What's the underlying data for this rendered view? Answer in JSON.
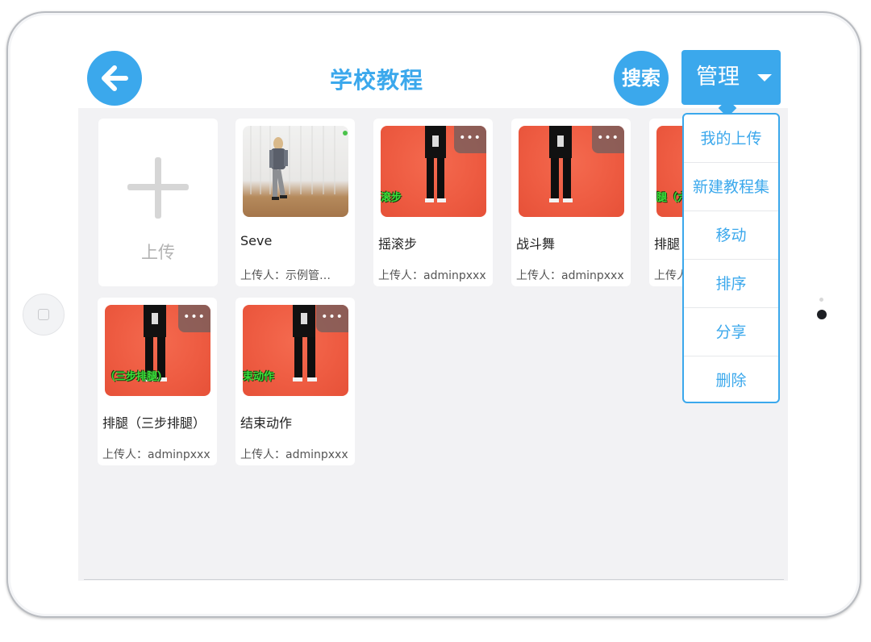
{
  "header": {
    "title": "学校教程",
    "search_label": "搜索",
    "manage_label": "管理"
  },
  "upload_tile": {
    "label": "上传"
  },
  "dropdown": {
    "items": [
      "我的上传",
      "新建教程集",
      "移动",
      "排序",
      "分享",
      "删除"
    ]
  },
  "cards": [
    {
      "name": "Seve",
      "uploader": "上传人：示例管…",
      "thumbnail": "studio"
    },
    {
      "name": "摇滚步",
      "uploader": "上传人：adminpxxx",
      "subtitle": "滚步",
      "thumbnail": "red"
    },
    {
      "name": "战斗舞",
      "uploader": "上传人：adminpxxx",
      "thumbnail": "red"
    },
    {
      "name": "排腿",
      "uploader": "上传人",
      "subtitle": "腿（六",
      "thumbnail": "red"
    },
    {
      "name": "排腿（三步排腿）",
      "uploader": "上传人：adminpxxx",
      "subtitle": "（三步排腿）",
      "thumbnail": "red"
    },
    {
      "name": "结束动作",
      "uploader": "上传人：adminpxxx",
      "subtitle": "束动作",
      "thumbnail": "red"
    }
  ],
  "more_label": "•••",
  "colors": {
    "accent": "#3ba8ec",
    "content_bg": "#f2f2f4",
    "thumb_red": "#ee5c42",
    "subtitle_green": "#39e03a"
  },
  "icons": {
    "back": "arrow-left-icon",
    "caret": "caret-down-icon",
    "plus": "plus-icon",
    "more": "more-horizontal-icon"
  }
}
